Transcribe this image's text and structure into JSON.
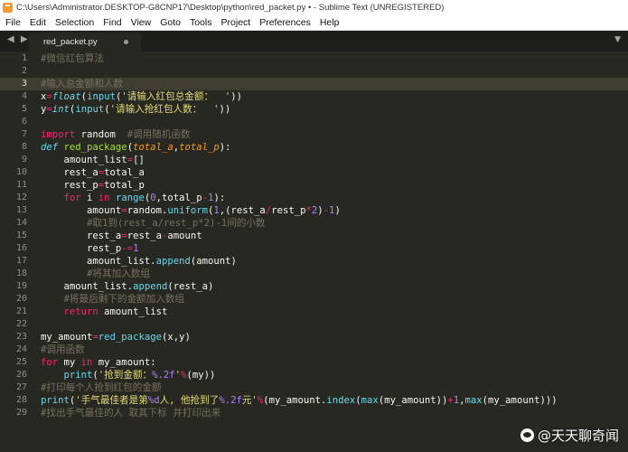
{
  "window": {
    "title": "C:\\Users\\Administrator.DESKTOP-G8CNP17\\Desktop\\python\\red_packet.py • - Sublime Text (UNREGISTERED)"
  },
  "menu": [
    "File",
    "Edit",
    "Selection",
    "Find",
    "View",
    "Goto",
    "Tools",
    "Project",
    "Preferences",
    "Help"
  ],
  "tabs": {
    "nav": "◀ ▶",
    "active": "red_packet.py",
    "dropdown": "▼"
  },
  "editor": {
    "active_line": 3,
    "lines": [
      "1",
      "2",
      "3",
      "4",
      "5",
      "6",
      "7",
      "8",
      "9",
      "10",
      "11",
      "12",
      "13",
      "14",
      "15",
      "16",
      "17",
      "18",
      "19",
      "20",
      "21",
      "22",
      "23",
      "24",
      "25",
      "26",
      "27",
      "28",
      "29"
    ],
    "code": [
      [
        [
          "c",
          "#微信红包算法"
        ]
      ],
      [],
      [
        [
          "c",
          "#输入总金额和人数"
        ]
      ],
      [
        [
          "p",
          "x"
        ],
        [
          "o",
          "="
        ],
        [
          "b",
          "float"
        ],
        [
          "p",
          "("
        ],
        [
          "f",
          "input"
        ],
        [
          "p",
          "("
        ],
        [
          "s",
          "'请输入红包总金额：  '"
        ],
        [
          "p",
          "))"
        ]
      ],
      [
        [
          "p",
          "y"
        ],
        [
          "o",
          "="
        ],
        [
          "b",
          "int"
        ],
        [
          "p",
          "("
        ],
        [
          "f",
          "input"
        ],
        [
          "p",
          "("
        ],
        [
          "s",
          "'请输入抢红包人数：  '"
        ],
        [
          "p",
          "))"
        ]
      ],
      [],
      [
        [
          "k",
          "import"
        ],
        [
          "p",
          " random  "
        ],
        [
          "c",
          "#调用随机函数"
        ]
      ],
      [
        [
          "d",
          "def"
        ],
        [
          "p",
          " "
        ],
        [
          "n",
          "red_package"
        ],
        [
          "p",
          "("
        ],
        [
          "a",
          "total_a"
        ],
        [
          "p",
          ","
        ],
        [
          "a",
          "total_p"
        ],
        [
          "p",
          "):"
        ]
      ],
      [
        [
          "p",
          "    amount_list"
        ],
        [
          "o",
          "="
        ],
        [
          "p",
          "[]"
        ]
      ],
      [
        [
          "p",
          "    rest_a"
        ],
        [
          "o",
          "="
        ],
        [
          "p",
          "total_a"
        ]
      ],
      [
        [
          "p",
          "    rest_p"
        ],
        [
          "o",
          "="
        ],
        [
          "p",
          "total_p"
        ]
      ],
      [
        [
          "p",
          "    "
        ],
        [
          "k",
          "for"
        ],
        [
          "p",
          " i "
        ],
        [
          "k",
          "in"
        ],
        [
          "p",
          " "
        ],
        [
          "f",
          "range"
        ],
        [
          "p",
          "("
        ],
        [
          "m",
          "0"
        ],
        [
          "p",
          ",total_p"
        ],
        [
          "o",
          "-"
        ],
        [
          "m",
          "1"
        ],
        [
          "p",
          "):"
        ]
      ],
      [
        [
          "p",
          "        amount"
        ],
        [
          "o",
          "="
        ],
        [
          "p",
          "random."
        ],
        [
          "f",
          "uniform"
        ],
        [
          "p",
          "("
        ],
        [
          "m",
          "1"
        ],
        [
          "p",
          ",(rest_a"
        ],
        [
          "o",
          "/"
        ],
        [
          "p",
          "rest_p"
        ],
        [
          "o",
          "*"
        ],
        [
          "m",
          "2"
        ],
        [
          "p",
          ")"
        ],
        [
          "o",
          "-"
        ],
        [
          "m",
          "1"
        ],
        [
          "p",
          ")"
        ]
      ],
      [
        [
          "p",
          "        "
        ],
        [
          "c",
          "#取1到(rest_a/rest_p*2)-1间的小数"
        ]
      ],
      [
        [
          "p",
          "        rest_a"
        ],
        [
          "o",
          "="
        ],
        [
          "p",
          "rest_a"
        ],
        [
          "o",
          "-"
        ],
        [
          "p",
          "amount"
        ]
      ],
      [
        [
          "p",
          "        rest_p"
        ],
        [
          "o",
          "-="
        ],
        [
          "m",
          "1"
        ]
      ],
      [
        [
          "p",
          "        amount_list."
        ],
        [
          "f",
          "append"
        ],
        [
          "p",
          "(amount)"
        ]
      ],
      [
        [
          "p",
          "        "
        ],
        [
          "c",
          "#将其加入数组"
        ]
      ],
      [
        [
          "p",
          "    amount_list."
        ],
        [
          "f",
          "append"
        ],
        [
          "p",
          "(rest_a)"
        ]
      ],
      [
        [
          "p",
          "    "
        ],
        [
          "c",
          "#将最后剩下的金额加入数组"
        ]
      ],
      [
        [
          "p",
          "    "
        ],
        [
          "k",
          "return"
        ],
        [
          "p",
          " amount_list"
        ]
      ],
      [],
      [
        [
          "p",
          "my_amount"
        ],
        [
          "o",
          "="
        ],
        [
          "f",
          "red_package"
        ],
        [
          "p",
          "(x,y)"
        ]
      ],
      [
        [
          "c",
          "#调用函数"
        ]
      ],
      [
        [
          "k",
          "for"
        ],
        [
          "p",
          " my "
        ],
        [
          "k",
          "in"
        ],
        [
          "p",
          " my_amount:"
        ]
      ],
      [
        [
          "p",
          "    "
        ],
        [
          "f",
          "print"
        ],
        [
          "p",
          "("
        ],
        [
          "s",
          "'抢到金额："
        ],
        [
          "m",
          "%.2f"
        ],
        [
          "s",
          "'"
        ],
        [
          "o",
          "%"
        ],
        [
          "p",
          "(my))"
        ]
      ],
      [
        [
          "c",
          "#打印每个人抢到红包的金额"
        ]
      ],
      [
        [
          "f",
          "print"
        ],
        [
          "p",
          "("
        ],
        [
          "s",
          "'手气最佳者是第"
        ],
        [
          "m",
          "%d"
        ],
        [
          "s",
          "人, 他抢到了"
        ],
        [
          "m",
          "%.2f"
        ],
        [
          "s",
          "元'"
        ],
        [
          "o",
          "%"
        ],
        [
          "p",
          "(my_amount."
        ],
        [
          "f",
          "index"
        ],
        [
          "p",
          "("
        ],
        [
          "f",
          "max"
        ],
        [
          "p",
          "(my_amount))"
        ],
        [
          "o",
          "+"
        ],
        [
          "m",
          "1"
        ],
        [
          "p",
          ","
        ],
        [
          "f",
          "max"
        ],
        [
          "p",
          "(my_amount)))"
        ]
      ],
      [
        [
          "c",
          "#找出手气最佳的人 取其下标 并打印出来"
        ]
      ]
    ]
  },
  "watermark": {
    "text": "@天天聊奇闻"
  },
  "colors": {
    "background": "#272822",
    "comment": "#75715e",
    "keyword": "#f92672",
    "string": "#e6db74",
    "number": "#ae81ff",
    "function": "#66d9ef",
    "def_name": "#a6e22e",
    "param": "#fd971f"
  }
}
